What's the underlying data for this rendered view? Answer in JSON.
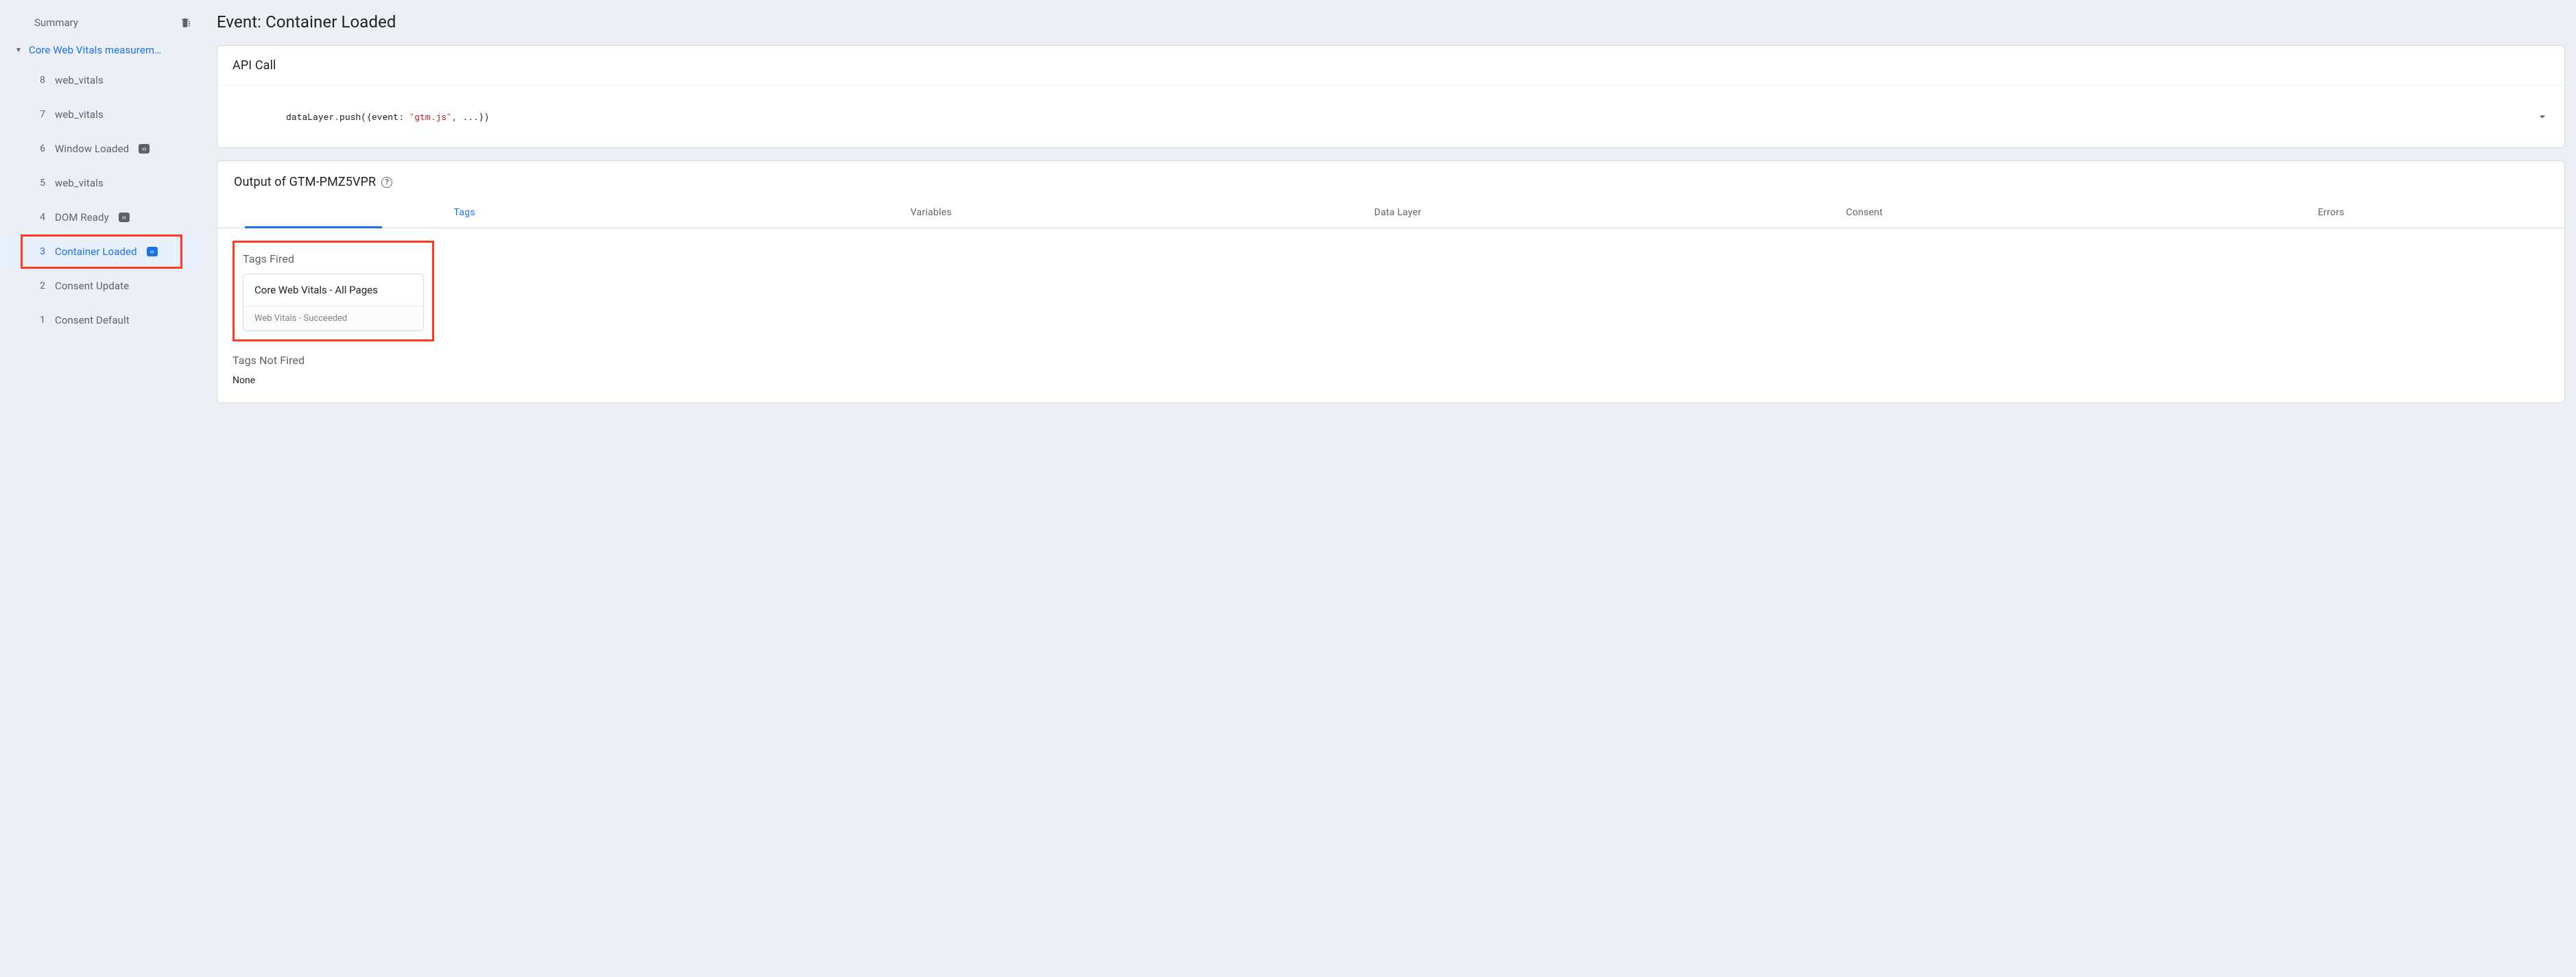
{
  "sidebar": {
    "summary_label": "Summary",
    "group_label": "Core Web Vitals measurem…",
    "items": [
      {
        "num": "8",
        "label": "web_vitals",
        "badge": false,
        "selected": false
      },
      {
        "num": "7",
        "label": "web_vitals",
        "badge": false,
        "selected": false
      },
      {
        "num": "6",
        "label": "Window Loaded",
        "badge": true,
        "selected": false
      },
      {
        "num": "5",
        "label": "web_vitals",
        "badge": false,
        "selected": false
      },
      {
        "num": "4",
        "label": "DOM Ready",
        "badge": true,
        "selected": false
      },
      {
        "num": "3",
        "label": "Container Loaded",
        "badge": true,
        "selected": true
      },
      {
        "num": "2",
        "label": "Consent Update",
        "badge": false,
        "selected": false
      },
      {
        "num": "1",
        "label": "Consent Default",
        "badge": false,
        "selected": false
      }
    ]
  },
  "main": {
    "title": "Event: Container Loaded",
    "api_call": {
      "title": "API Call",
      "code_prefix": "dataLayer.push({",
      "code_key": "event: ",
      "code_str": "\"gtm.js\"",
      "code_suffix": ", ...})"
    },
    "output": {
      "title": "Output of GTM-PMZ5VPR",
      "tabs": [
        "Tags",
        "Variables",
        "Data Layer",
        "Consent",
        "Errors"
      ],
      "fired_label": "Tags Fired",
      "not_fired_label": "Tags Not Fired",
      "none_text": "None",
      "tag_card": {
        "title": "Core Web Vitals - All Pages",
        "subtitle": "Web Vitals - Succeeded"
      }
    }
  }
}
